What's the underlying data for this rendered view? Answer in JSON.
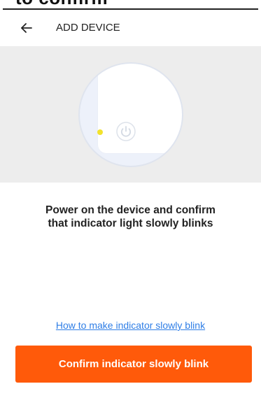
{
  "cropped_header_text": "to confirm",
  "header": {
    "back_icon": "arrow-left-icon",
    "title": "ADD DEVICE"
  },
  "illustration": {
    "indicator_color": "#f2e22c",
    "power_icon": "power-icon"
  },
  "instruction": {
    "line1": "Power on the device and confirm",
    "line2": "that indicator light slowly blinks"
  },
  "help_link": "How to make indicator slowly blink",
  "confirm_button": "Confirm indicator slowly blink",
  "colors": {
    "accent": "#ff5a0a",
    "link": "#2f7ee6"
  }
}
